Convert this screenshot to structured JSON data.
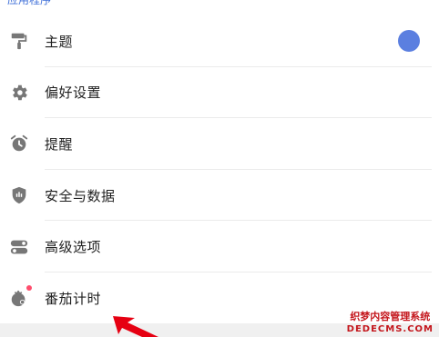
{
  "section_header": "应用程序",
  "settings": {
    "items": [
      {
        "label": "主题",
        "icon": "paint-roller-icon",
        "accent": "#5b7fe0"
      },
      {
        "label": "偏好设置",
        "icon": "gear-icon"
      },
      {
        "label": "提醒",
        "icon": "alarm-clock-icon"
      },
      {
        "label": "安全与数据",
        "icon": "shield-icon"
      },
      {
        "label": "高级选项",
        "icon": "toggle-icon"
      },
      {
        "label": "番茄计时",
        "icon": "tomato-timer-icon",
        "badge_color": "#ff4d6d"
      }
    ]
  },
  "watermark": {
    "line1": "织梦内容管理系统",
    "line2": "DEDECMS.COM"
  },
  "colors": {
    "icon": "#777777",
    "theme_dot": "#5b7fe0",
    "arrow": "#e60012",
    "watermark": "#c4161c"
  }
}
